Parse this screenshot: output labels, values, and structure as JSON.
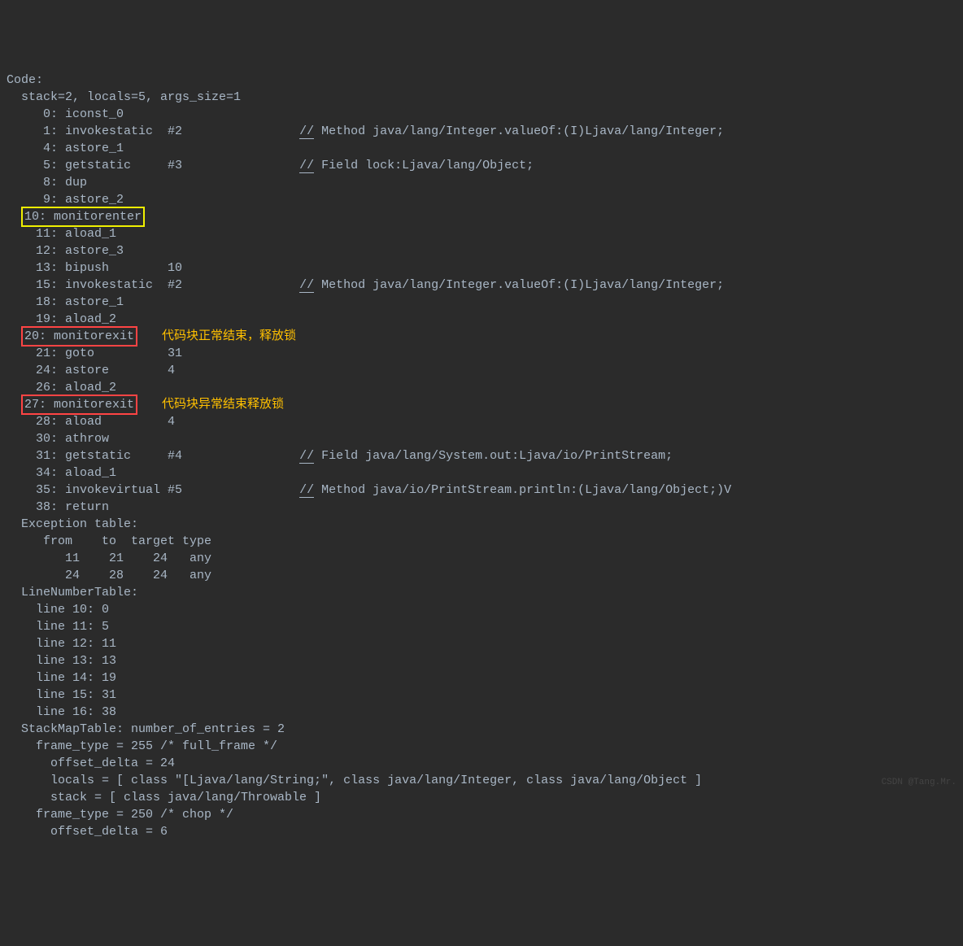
{
  "header": {
    "code_label": "Code:",
    "stack_line": "  stack=2, locals=5, args_size=1"
  },
  "instructions": [
    {
      "pc": "     0:",
      "op": "iconst_0",
      "arg": "",
      "comment": "",
      "box": ""
    },
    {
      "pc": "     1:",
      "op": "invokestatic ",
      "arg": " #2",
      "comment": "// Method java/lang/Integer.valueOf:(I)Ljava/lang/Integer;",
      "box": ""
    },
    {
      "pc": "     4:",
      "op": "astore_1",
      "arg": "",
      "comment": "",
      "box": ""
    },
    {
      "pc": "     5:",
      "op": "getstatic    ",
      "arg": " #3",
      "comment": "// Field lock:Ljava/lang/Object;",
      "box": ""
    },
    {
      "pc": "     8:",
      "op": "dup",
      "arg": "",
      "comment": "",
      "box": ""
    },
    {
      "pc": "     9:",
      "op": "astore_2",
      "arg": "",
      "comment": "",
      "box": ""
    },
    {
      "pc": "    10:",
      "op": "monitorenter",
      "arg": "",
      "comment": "",
      "box": "yellow"
    },
    {
      "pc": "    11:",
      "op": "aload_1",
      "arg": "",
      "comment": "",
      "box": ""
    },
    {
      "pc": "    12:",
      "op": "astore_3",
      "arg": "",
      "comment": "",
      "box": ""
    },
    {
      "pc": "    13:",
      "op": "bipush       ",
      "arg": " 10",
      "comment": "",
      "box": ""
    },
    {
      "pc": "    15:",
      "op": "invokestatic ",
      "arg": " #2",
      "comment": "// Method java/lang/Integer.valueOf:(I)Ljava/lang/Integer;",
      "box": ""
    },
    {
      "pc": "    18:",
      "op": "astore_1",
      "arg": "",
      "comment": "",
      "box": ""
    },
    {
      "pc": "    19:",
      "op": "aload_2",
      "arg": "",
      "comment": "",
      "box": ""
    },
    {
      "pc": "    20:",
      "op": "monitorexit",
      "arg": "",
      "comment": "",
      "box": "red",
      "anno": "代码块正常结束，释放锁"
    },
    {
      "pc": "    21:",
      "op": "goto         ",
      "arg": " 31",
      "comment": "",
      "box": ""
    },
    {
      "pc": "    24:",
      "op": "astore       ",
      "arg": " 4",
      "comment": "",
      "box": ""
    },
    {
      "pc": "    26:",
      "op": "aload_2",
      "arg": "",
      "comment": "",
      "box": ""
    },
    {
      "pc": "    27:",
      "op": "monitorexit",
      "arg": "",
      "comment": "",
      "box": "red",
      "anno": "代码块异常结束释放锁"
    },
    {
      "pc": "    28:",
      "op": "aload        ",
      "arg": " 4",
      "comment": "",
      "box": ""
    },
    {
      "pc": "    30:",
      "op": "athrow",
      "arg": "",
      "comment": "",
      "box": ""
    },
    {
      "pc": "    31:",
      "op": "getstatic    ",
      "arg": " #4",
      "comment": "// Field java/lang/System.out:Ljava/io/PrintStream;",
      "box": ""
    },
    {
      "pc": "    34:",
      "op": "aload_1",
      "arg": "",
      "comment": "",
      "box": ""
    },
    {
      "pc": "    35:",
      "op": "invokevirtual",
      "arg": " #5",
      "comment": "// Method java/io/PrintStream.println:(Ljava/lang/Object;)V",
      "box": ""
    },
    {
      "pc": "    38:",
      "op": "return",
      "arg": "",
      "comment": "",
      "box": ""
    }
  ],
  "exception_table": {
    "title": "  Exception table:",
    "header": "     from    to  target type",
    "rows": [
      "        11    21    24   any",
      "        24    28    24   any"
    ]
  },
  "line_number_table": {
    "title": "  LineNumberTable:",
    "rows": [
      "    line 10: 0",
      "    line 11: 5",
      "    line 12: 11",
      "    line 13: 13",
      "    line 14: 19",
      "    line 15: 31",
      "    line 16: 38"
    ]
  },
  "stack_map_table": {
    "title": "  StackMapTable: number_of_entries = 2",
    "rows": [
      "    frame_type = 255 /* full_frame */",
      "      offset_delta = 24",
      "      locals = [ class \"[Ljava/lang/String;\", class java/lang/Integer, class java/lang/Object ]",
      "      stack = [ class java/lang/Throwable ]",
      "    frame_type = 250 /* chop */",
      "      offset_delta = 6"
    ]
  },
  "watermark": "CSDN @Tang.Mr."
}
